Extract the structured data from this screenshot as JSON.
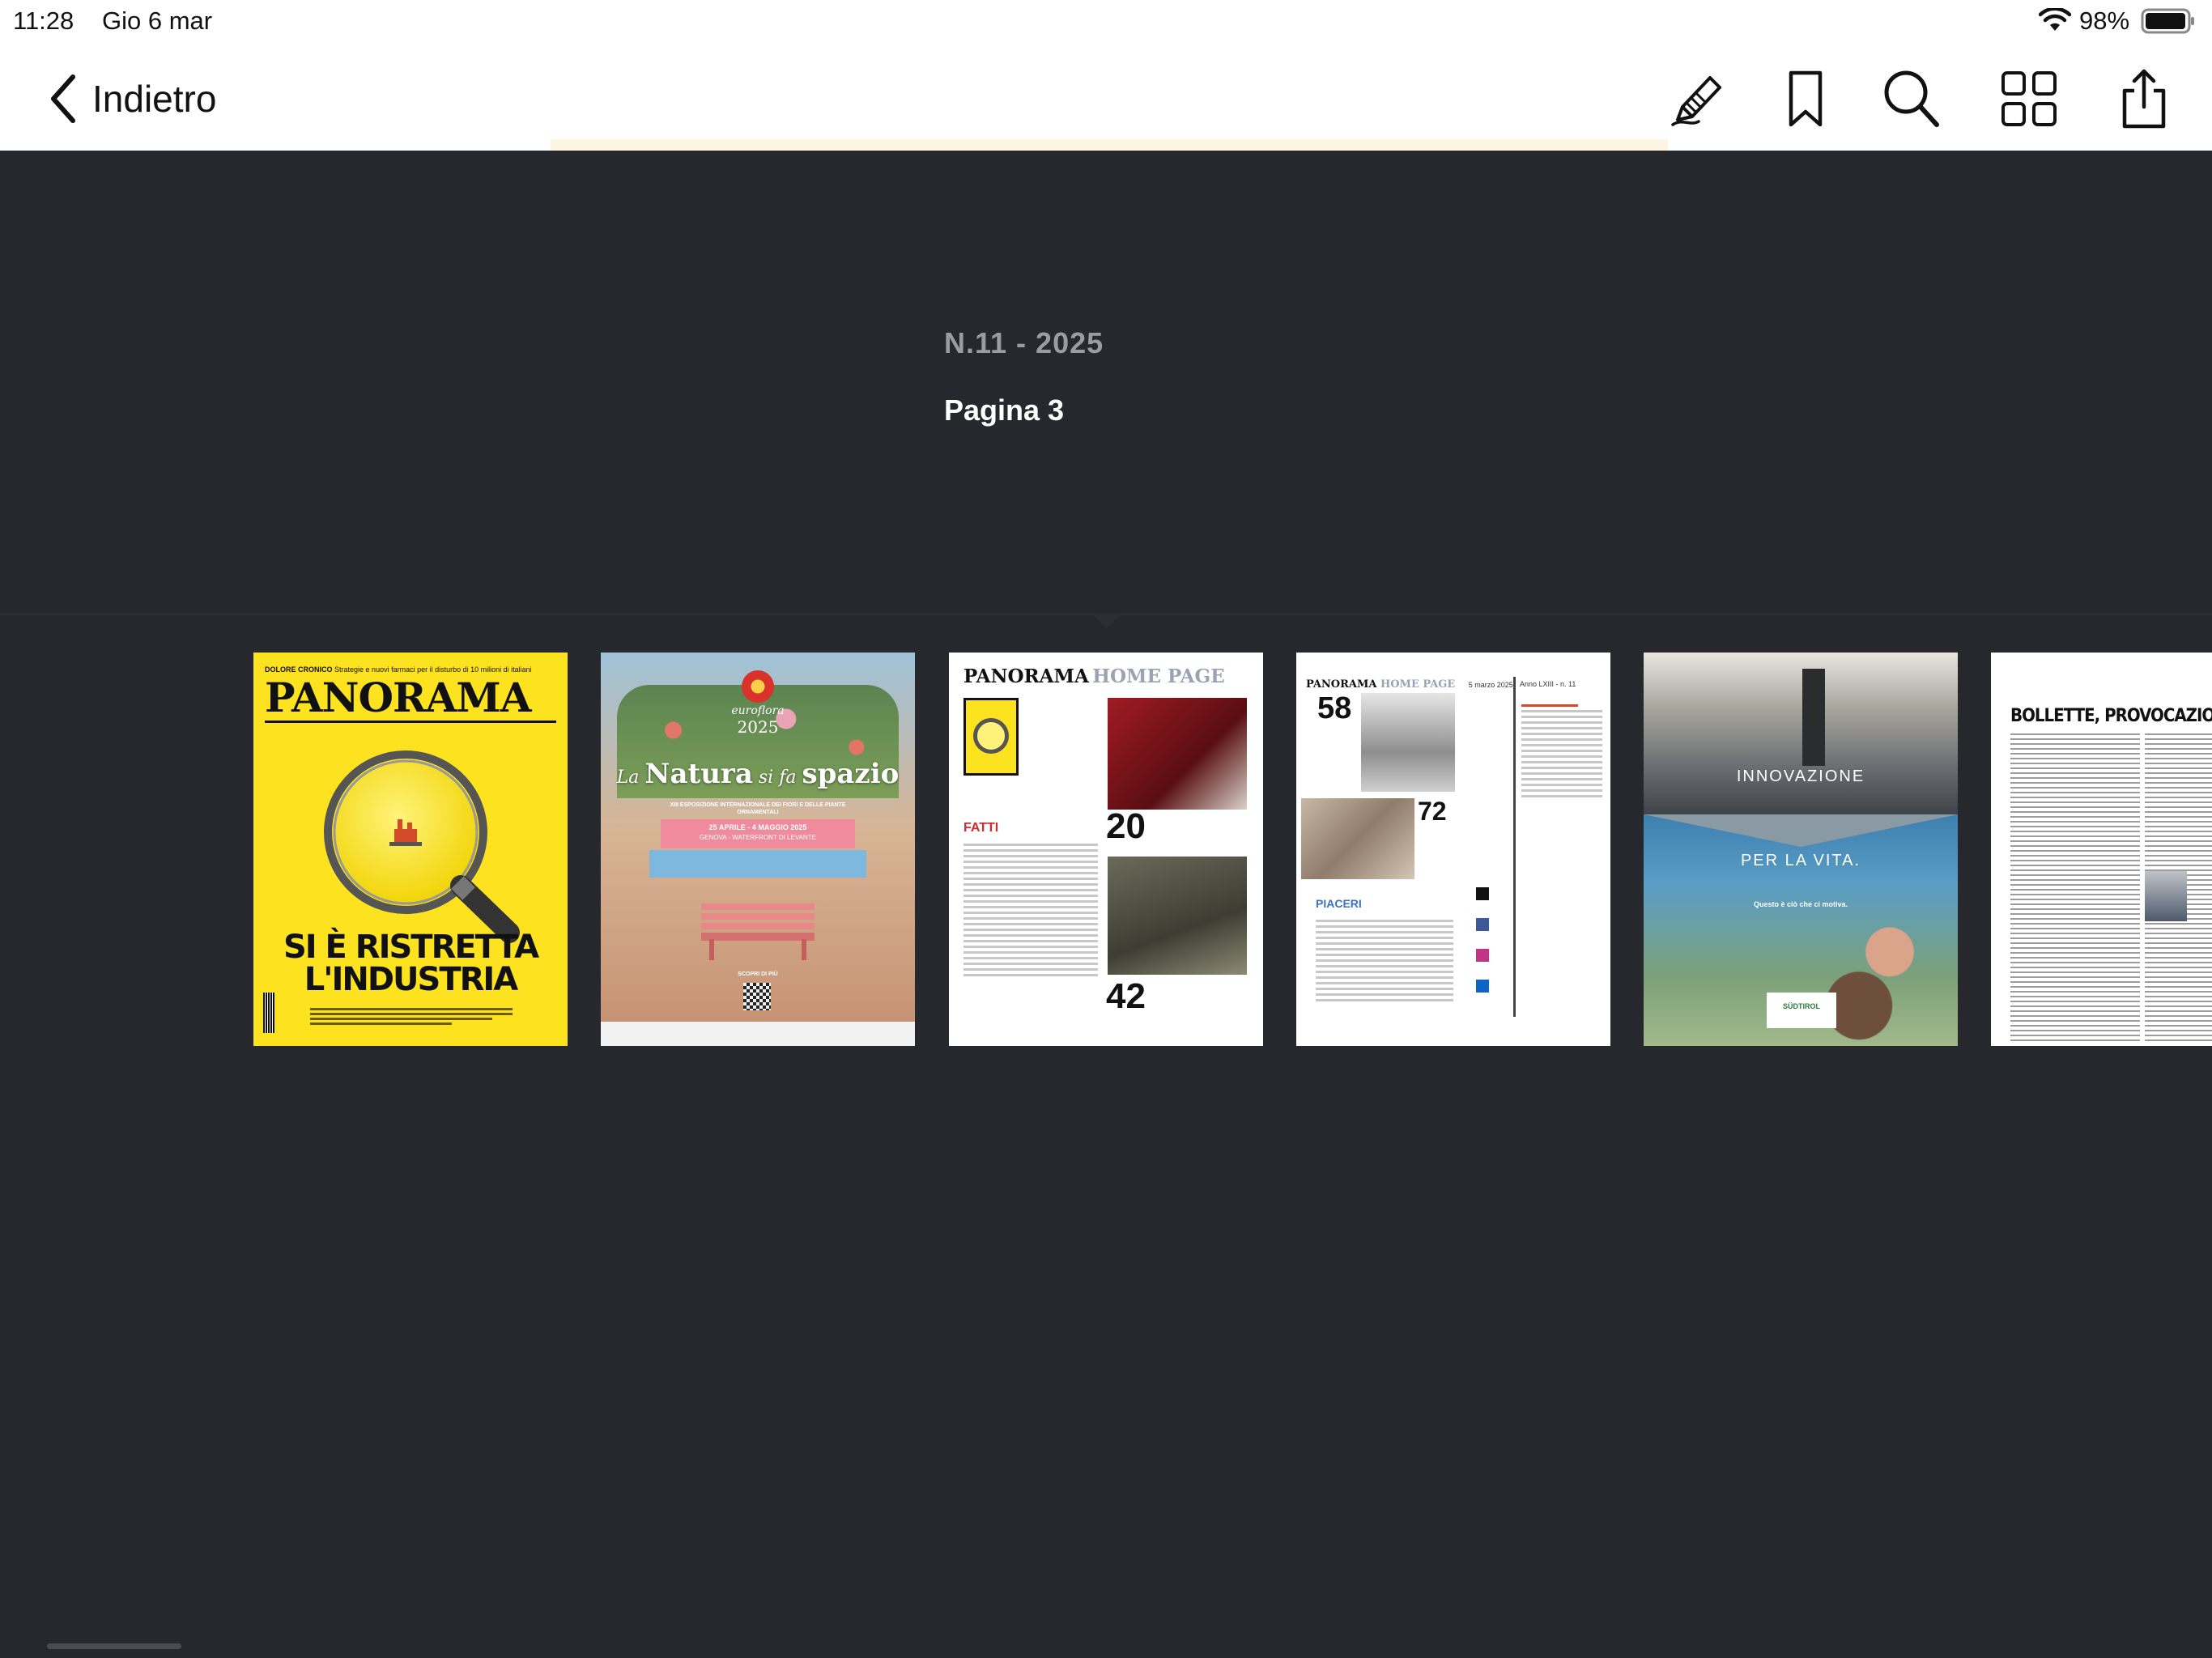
{
  "status_bar": {
    "time": "11:28",
    "date": "Gio 6 mar",
    "battery_percent": "98%",
    "battery_level": 0.98
  },
  "nav": {
    "back_label": "Indietro",
    "tools": [
      "annotate-icon",
      "bookmark-icon",
      "search-icon",
      "grid-icon",
      "share-icon"
    ]
  },
  "reader": {
    "issue": "N.11 - 2025",
    "page": "Pagina 3"
  },
  "thumbnails": {
    "cover": {
      "kicker_bold": "DOLORE CRONICO",
      "kicker": "Strategie e nuovi farmaci per il disturbo di 10 milioni di italiani",
      "masthead": "PANORAMA",
      "headline_1": "SI È RISTRETTA",
      "headline_2": "L'INDUSTRIA"
    },
    "ad_euroflora": {
      "logo": "euroflora",
      "year": "2025",
      "headline_a": "La ",
      "headline_b": "Natura",
      "headline_c": " si fa ",
      "headline_d": "spazio",
      "subtitle": "XIII ESPOSIZIONE INTERNAZIONALE DEI FIORI E DELLE PIANTE ORNAMENTALI",
      "dates": "25 APRILE - 4 MAGGIO 2025",
      "place": "GENOVA - WATERFRONT DI LEVANTE",
      "cta": "SCOPRI DI PIÙ"
    },
    "toc_1": {
      "masthead": "PANORAMA",
      "section": "HOME PAGE",
      "fatti": "FATTI",
      "num_a": "20",
      "num_b": "42"
    },
    "toc_2": {
      "masthead": "PANORAMA",
      "section": "HOME PAGE",
      "date": "5 marzo 2025",
      "volume": "Anno LXIII - n. 11",
      "num_a": "58",
      "num_b": "72",
      "piaceri": "PIACERI"
    },
    "ad_sudtirol": {
      "title": "INNOVAZIONE",
      "title2": "PER LA VITA.",
      "tagline": "Questo è ciò che ci motiva.",
      "brand": "SÜDTIROL"
    },
    "article": {
      "headline": "BOLLETTE, PROVOCAZIONI"
    }
  }
}
